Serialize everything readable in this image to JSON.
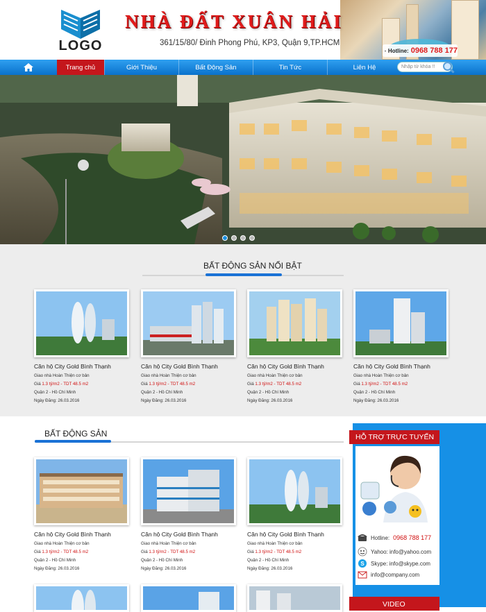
{
  "header": {
    "logo_text": "LOGO",
    "site_title": "NHÀ ĐẤT XUÂN HẢI",
    "address": "361/15/80/ Đinh Phong Phú, KP3, Quận 9,TP.HCM",
    "hotline_label": "Hotline:",
    "hotline_number": "0968 788 177"
  },
  "nav": {
    "home_icon": "home-icon",
    "items": [
      "Trang chủ",
      "Giới Thiệu",
      "Bất Động Sản",
      "Tin Tức",
      "Liên Hệ"
    ],
    "search_placeholder": "Nhập từ khóa !!"
  },
  "banner": {
    "slides": 4,
    "active_slide": 1
  },
  "featured": {
    "title": "BẤT ĐỘNG SẢN NỔI BẬT",
    "cards": [
      {
        "name": "Căn hộ City Gold Bình Thạnh",
        "desc": "Giao nhà Hoàn Thiện cơ bản",
        "price_label": "Giá",
        "price": "1.3 tỷ/m2 - TDT 48.5 m2",
        "location": "Quận 2 - Hồ Chí Minh",
        "date": "Ngày Đăng: 26.03.2016"
      },
      {
        "name": "Căn hộ City Gold Bình Thạnh",
        "desc": "Giao nhà Hoàn Thiện cơ bản",
        "price_label": "Giá",
        "price": "1.3 tỷ/m2 - TDT 48.5 m2",
        "location": "Quận 2 - Hồ Chí Minh",
        "date": "Ngày Đăng: 26.03.2016"
      },
      {
        "name": "Căn hộ City Gold Bình Thạnh",
        "desc": "Giao nhà Hoàn Thiện cơ bản",
        "price_label": "Giá",
        "price": "1.3 tỷ/m2 - TDT 48.5 m2",
        "location": "Quận 2 - Hồ Chí Minh",
        "date": "Ngày Đăng: 26.03.2016"
      },
      {
        "name": "Căn hộ City Gold Bình Thạnh",
        "desc": "Giao nhà Hoàn Thiện cơ bản",
        "price_label": "Giá",
        "price": "1.3 tỷ/m2 - TDT 48.5 m2",
        "location": "Quận 2 - Hồ Chí Minh",
        "date": "Ngày Đăng: 26.03.2016"
      }
    ]
  },
  "listing": {
    "title": "BẤT ĐỘNG SẢN",
    "cards": [
      {
        "name": "Căn hộ City Gold Bình Thạnh",
        "desc": "Giao nhà Hoàn Thiện cơ bản",
        "price_label": "Giá",
        "price": "1.3 tỷ/m2 - TDT 48.5 m2",
        "location": "Quận 2 - Hồ Chí Minh",
        "date": "Ngày Đăng: 26.03.2016"
      },
      {
        "name": "Căn hộ City Gold Bình Thạnh",
        "desc": "Giao nhà Hoàn Thiện cơ bản",
        "price_label": "Giá",
        "price": "1.3 tỷ/m2 - TDT 48.5 m2",
        "location": "Quận 2 - Hồ Chí Minh",
        "date": "Ngày Đăng: 26.03.2016"
      },
      {
        "name": "Căn hộ City Gold Bình Thạnh",
        "desc": "Giao nhà Hoàn Thiện cơ bản",
        "price_label": "Giá",
        "price": "1.3 tỷ/m2 - TDT 48.5 m2",
        "location": "Quận 2 - Hồ Chí Minh",
        "date": "Ngày Đăng: 26.03.2016"
      }
    ]
  },
  "sidebar": {
    "support_title": "HỖ TRỢ TRỰC TUYẾN",
    "hotline_label": "Hotline:",
    "hotline_number": "0968 788 177",
    "yahoo": "Yahoo: info@yahoo.com",
    "skype": "Skype: info@skype.com",
    "email": "info@company.com",
    "video_title": "VIDEO"
  },
  "colors": {
    "accent_blue": "#1690e6",
    "accent_red": "#c4161c",
    "price_red": "#d01010"
  }
}
